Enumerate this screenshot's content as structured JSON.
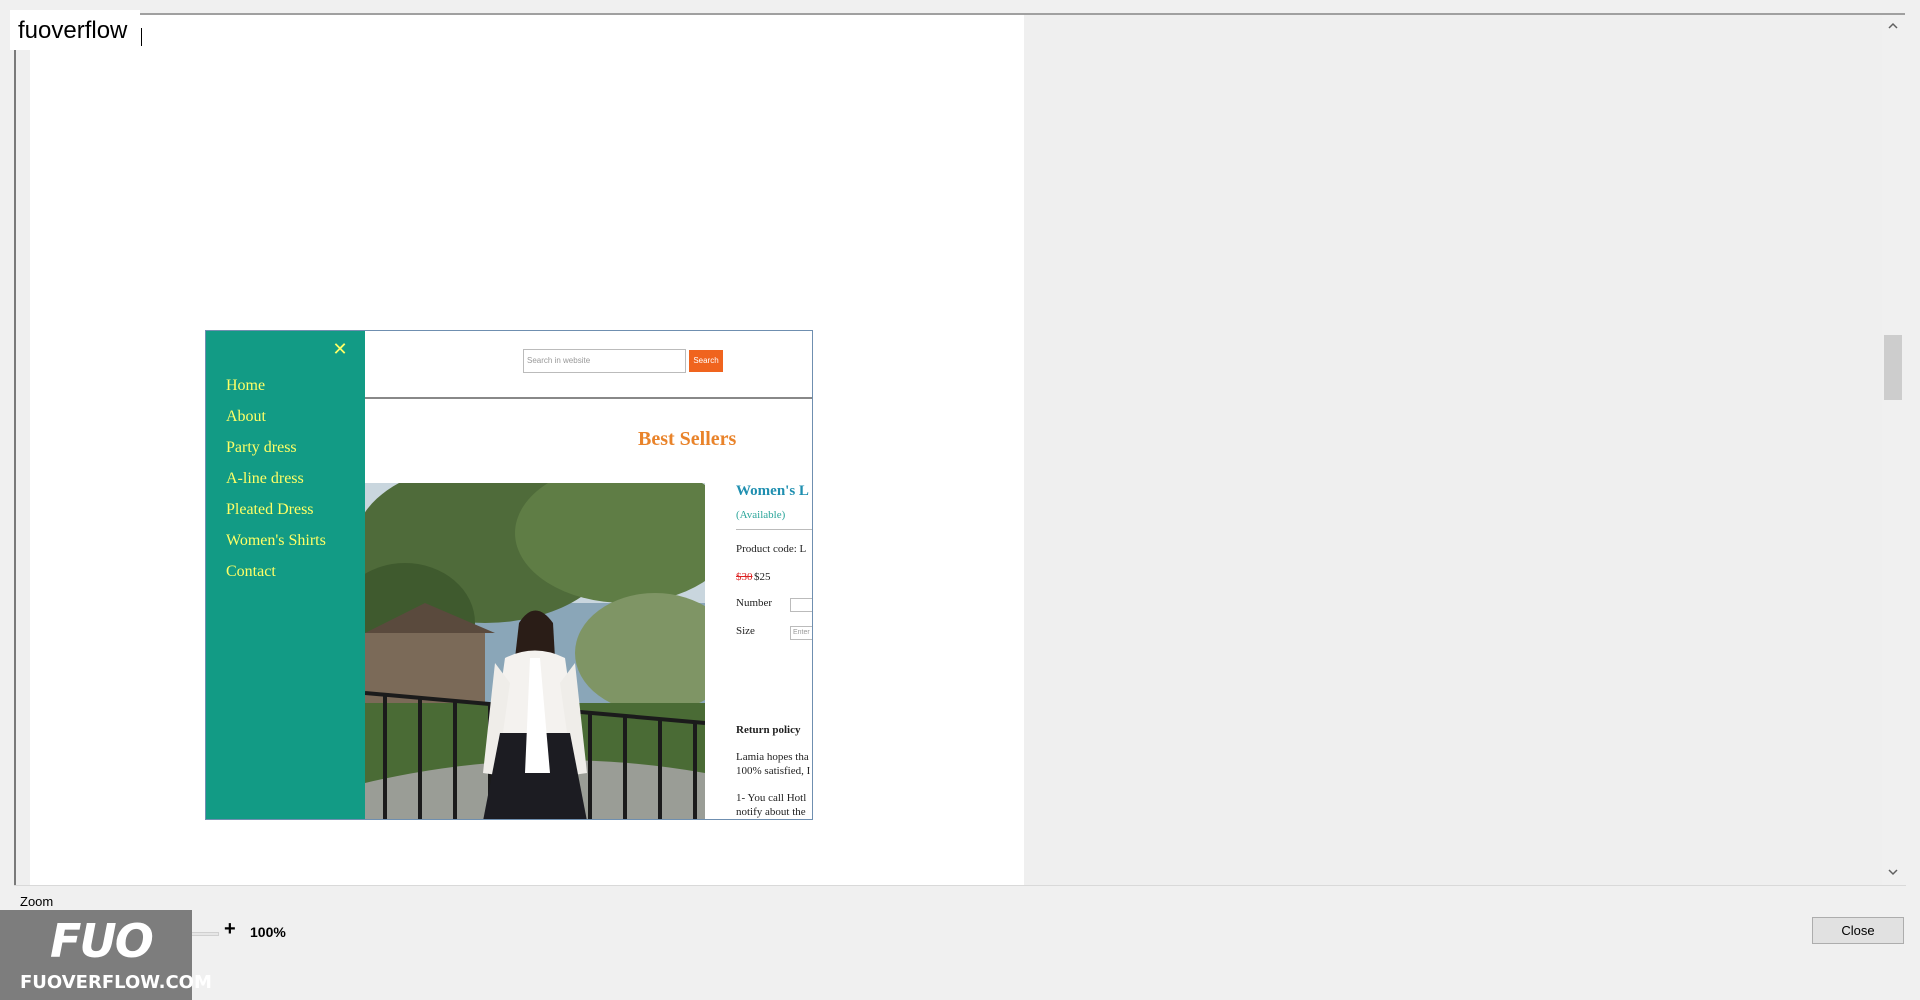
{
  "window": {
    "title": "fuoverflow"
  },
  "site": {
    "nav": {
      "close_symbol": "✕",
      "items": [
        {
          "label": "Home"
        },
        {
          "label": "About"
        },
        {
          "label": "Party dress"
        },
        {
          "label": "A-line dress"
        },
        {
          "label": "Pleated Dress"
        },
        {
          "label": "Women's Shirts"
        },
        {
          "label": "Contact"
        }
      ]
    },
    "search": {
      "placeholder": "Search in website",
      "button_label": "Search"
    },
    "heading": "Best Sellers",
    "product": {
      "title": "Women's L",
      "availability": "(Available)",
      "code": "Product code: L",
      "price_old": "$30",
      "price_new": "$25",
      "number_label": "Number",
      "size_label": "Size",
      "size_placeholder": "Enter",
      "return_title": "Return policy",
      "return_line1": "Lamia hopes tha",
      "return_line2": "100% satisfied, I",
      "return_line3": "1- You call Hotl",
      "return_line4": "notify about the"
    }
  },
  "scrollbar": {
    "up_icon": "chevron-up-icon",
    "down_icon": "chevron-down-icon"
  },
  "zoom": {
    "label": "Zoom",
    "minus": "-",
    "plus": "+",
    "value": "100%",
    "level": 0.5
  },
  "footer": {
    "close_label": "Close"
  },
  "watermark": {
    "logo": "FUO",
    "text": "FUOVERFLOW.COM"
  },
  "colors": {
    "nav_bg": "#129b85",
    "nav_text": "#ffff66",
    "heading": "#e9832a",
    "search_button": "#f0641e",
    "product_title": "#1f8fb0",
    "zoom_thumb": "#0f6dc9"
  }
}
